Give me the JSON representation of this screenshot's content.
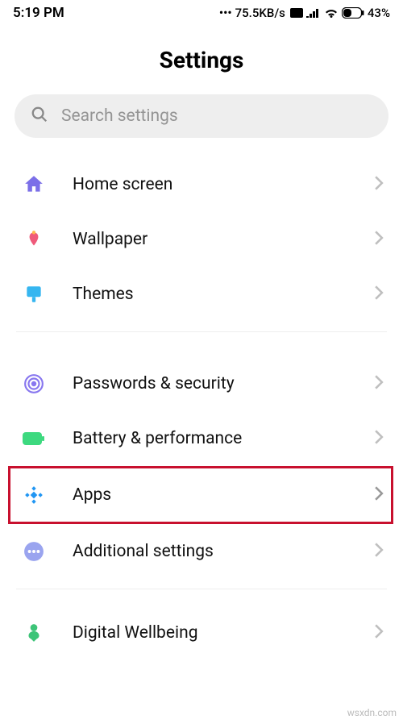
{
  "status": {
    "time": "5:19 PM",
    "speed": "75.5KB/s",
    "battery": "43%"
  },
  "page": {
    "title": "Settings"
  },
  "search": {
    "placeholder": "Search settings"
  },
  "items": {
    "home": "Home screen",
    "wallpaper": "Wallpaper",
    "themes": "Themes",
    "passwords": "Passwords & security",
    "battery": "Battery & performance",
    "apps": "Apps",
    "additional": "Additional settings",
    "wellbeing": "Digital Wellbeing"
  },
  "watermark": "wsxdn.com"
}
